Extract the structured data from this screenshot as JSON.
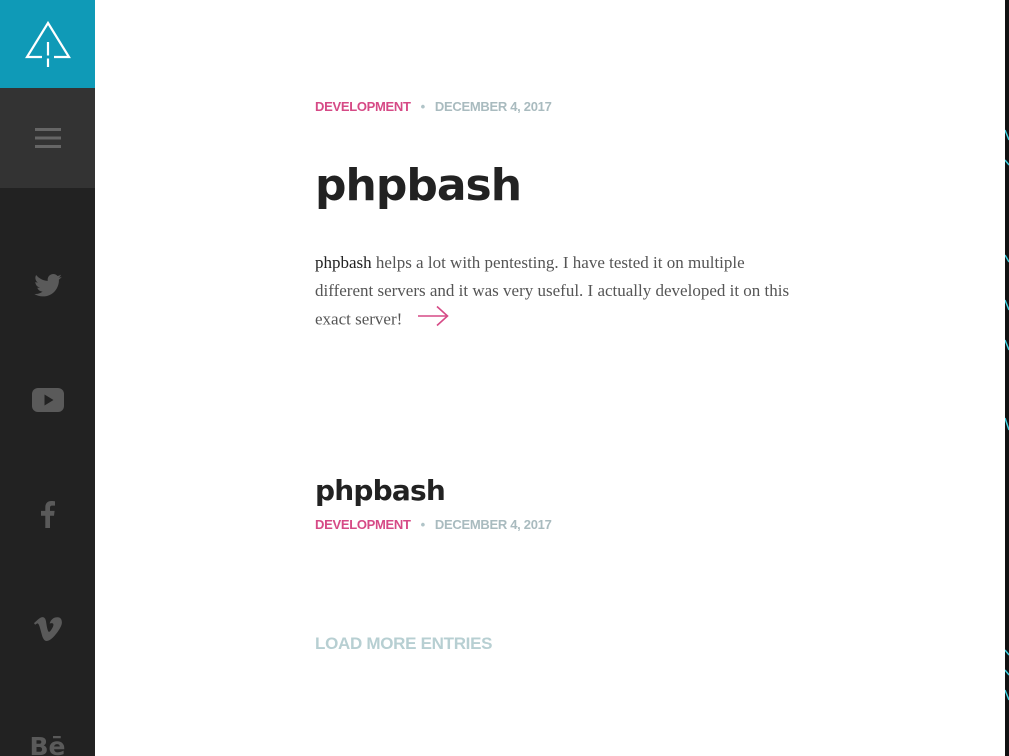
{
  "sidebar": {
    "logo_icon": "tree-outline-icon",
    "menu_icon": "hamburger-menu-icon",
    "social": [
      {
        "name": "twitter-icon"
      },
      {
        "name": "youtube-icon"
      },
      {
        "name": "facebook-icon"
      },
      {
        "name": "vimeo-icon"
      },
      {
        "name": "behance-icon",
        "text": "Bē"
      }
    ],
    "colors": {
      "logo_bg": "#0f9ab7",
      "menu_bg": "#333333",
      "sidebar_bg": "#222222",
      "icon": "#5a5a5a"
    }
  },
  "featured_post": {
    "category": "DEVELOPMENT",
    "separator": "•",
    "date": "DECEMBER 4, 2017",
    "title": "phpbash",
    "excerpt_lead": "phpbash",
    "excerpt_rest": " helps a lot with pentesting. I have tested it on multiple different servers and it was very useful. I actually developed it on this exact server!",
    "read_more_icon": "arrow-right-icon"
  },
  "post_list": [
    {
      "title": "phpbash",
      "category": "DEVELOPMENT",
      "separator": "•",
      "date": "DECEMBER 4, 2017"
    }
  ],
  "load_more_label": "LOAD MORE ENTRIES",
  "colors": {
    "accent": "#d64a86",
    "muted": "#a9bbbf",
    "heading": "#222222",
    "load_more": "#b7cfd2"
  }
}
